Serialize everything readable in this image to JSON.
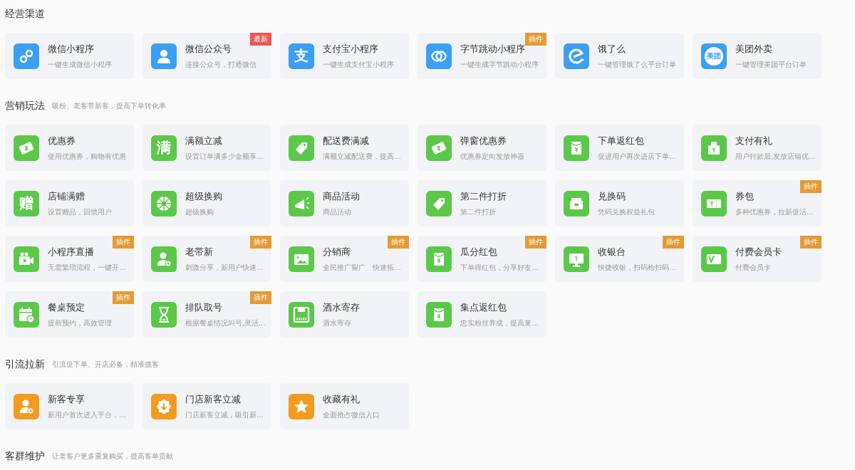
{
  "sections": [
    {
      "title": "经营渠道",
      "color": "#3a9ff5",
      "items": [
        {
          "title": "微信小程序",
          "desc": "一键生成微信小程序",
          "kind": "link"
        },
        {
          "title": "微信公众号",
          "desc": "连接公众号，打通微信",
          "kind": "person",
          "badge": {
            "text": "最新",
            "kind": "new"
          }
        },
        {
          "title": "支付宝小程序",
          "desc": "一键生成支付宝小程序",
          "kind": "glyph",
          "glyph": "支"
        },
        {
          "title": "字节跳动小程序",
          "desc": "一键生成字节跳动小程序",
          "kind": "ring",
          "badge": {
            "text": "插件",
            "kind": "plugin"
          }
        },
        {
          "title": "饿了么",
          "desc": "一键管理饿了么平台订单",
          "kind": "e"
        },
        {
          "title": "美团外卖",
          "desc": "一键管理美团平台订单",
          "kind": "glyphcircle",
          "glyph": "美团"
        }
      ]
    },
    {
      "title": "营销玩法",
      "subtitle": "吸粉、老客带新客，提高下单转化率",
      "color": "#5cc84a",
      "items": [
        {
          "title": "优惠券",
          "desc": "使用优惠券，购物有优惠",
          "kind": "ticket"
        },
        {
          "title": "满额立减",
          "desc": "设置订单满多少金额享…",
          "kind": "glyph",
          "glyph": "满"
        },
        {
          "title": "配送费满减",
          "desc": "满额立减配送费，提高…",
          "kind": "tag"
        },
        {
          "title": "弹窗优惠券",
          "desc": "优惠券定向发放神器",
          "kind": "ticket"
        },
        {
          "title": "下单返红包",
          "desc": "促进用户再次进店下单…",
          "kind": "envelope"
        },
        {
          "title": "支付有礼",
          "desc": "用户付款后,发放店铺优…",
          "kind": "gift"
        },
        {
          "title": "店铺满赠",
          "desc": "设置赠品，回馈用户",
          "kind": "glyph",
          "glyph": "赠"
        },
        {
          "title": "超级换购",
          "desc": "超级换购",
          "kind": "wheel"
        },
        {
          "title": "商品活动",
          "desc": "商品活动",
          "kind": "megaphone"
        },
        {
          "title": "第二件打折",
          "desc": "第二件打折",
          "kind": "tag"
        },
        {
          "title": "兑换码",
          "desc": "凭码兑换权益礼包",
          "kind": "giftbox"
        },
        {
          "title": "券包",
          "desc": "多种优惠券，拉新促活…",
          "kind": "voucher",
          "badge": {
            "text": "插件",
            "kind": "plugin"
          }
        },
        {
          "title": "小程序直播",
          "desc": "无需繁琐流程，一键开…",
          "kind": "camera",
          "badge": {
            "text": "插件",
            "kind": "plugin"
          }
        },
        {
          "title": "老带新",
          "desc": "刺激分享，新用户快速…",
          "kind": "personplus",
          "badge": {
            "text": "插件",
            "kind": "plugin"
          }
        },
        {
          "title": "分销商",
          "desc": "全民推广裂广　快速拓…",
          "kind": "image",
          "badge": {
            "text": "插件",
            "kind": "plugin"
          }
        },
        {
          "title": "瓜分红包",
          "desc": "下单得红包，分享好友…",
          "kind": "envelope",
          "badge": {
            "text": "插件",
            "kind": "plugin"
          }
        },
        {
          "title": "收银台",
          "desc": "快捷收银，扫码枪扫码…",
          "kind": "monitor",
          "badge": {
            "text": "插件",
            "kind": "plugin"
          }
        },
        {
          "title": "付费会员卡",
          "desc": "付费会员卡",
          "kind": "card",
          "badge": {
            "text": "插件",
            "kind": "plugin"
          }
        },
        {
          "title": "餐桌预定",
          "desc": "提前预约，高效管理",
          "kind": "calendar",
          "badge": {
            "text": "插件",
            "kind": "plugin"
          }
        },
        {
          "title": "排队取号",
          "desc": "根据餐桌情况叫号,灵活…",
          "kind": "hourglass",
          "badge": {
            "text": "插件",
            "kind": "plugin"
          }
        },
        {
          "title": "酒水寄存",
          "desc": "酒水寄存",
          "kind": "floppy"
        },
        {
          "title": "集点返红包",
          "desc": "忠实粉丝养成，提高复…",
          "kind": "envelope"
        }
      ]
    },
    {
      "title": "引流拉新",
      "subtitle": "引流促下单、开店必备，精准揽客",
      "color": "#f29c1f",
      "items": [
        {
          "title": "新客专享",
          "desc": "新用户首次进入平台，…",
          "kind": "personplus"
        },
        {
          "title": "门店新客立减",
          "desc": "门店新客立减，吸引新…",
          "kind": "downbadge"
        },
        {
          "title": "收藏有礼",
          "desc": "全面抢占微信入口",
          "kind": "star"
        }
      ]
    },
    {
      "title": "客群维护",
      "subtitle": "让老客户更多重复购买，提高客单贡献"
    }
  ]
}
